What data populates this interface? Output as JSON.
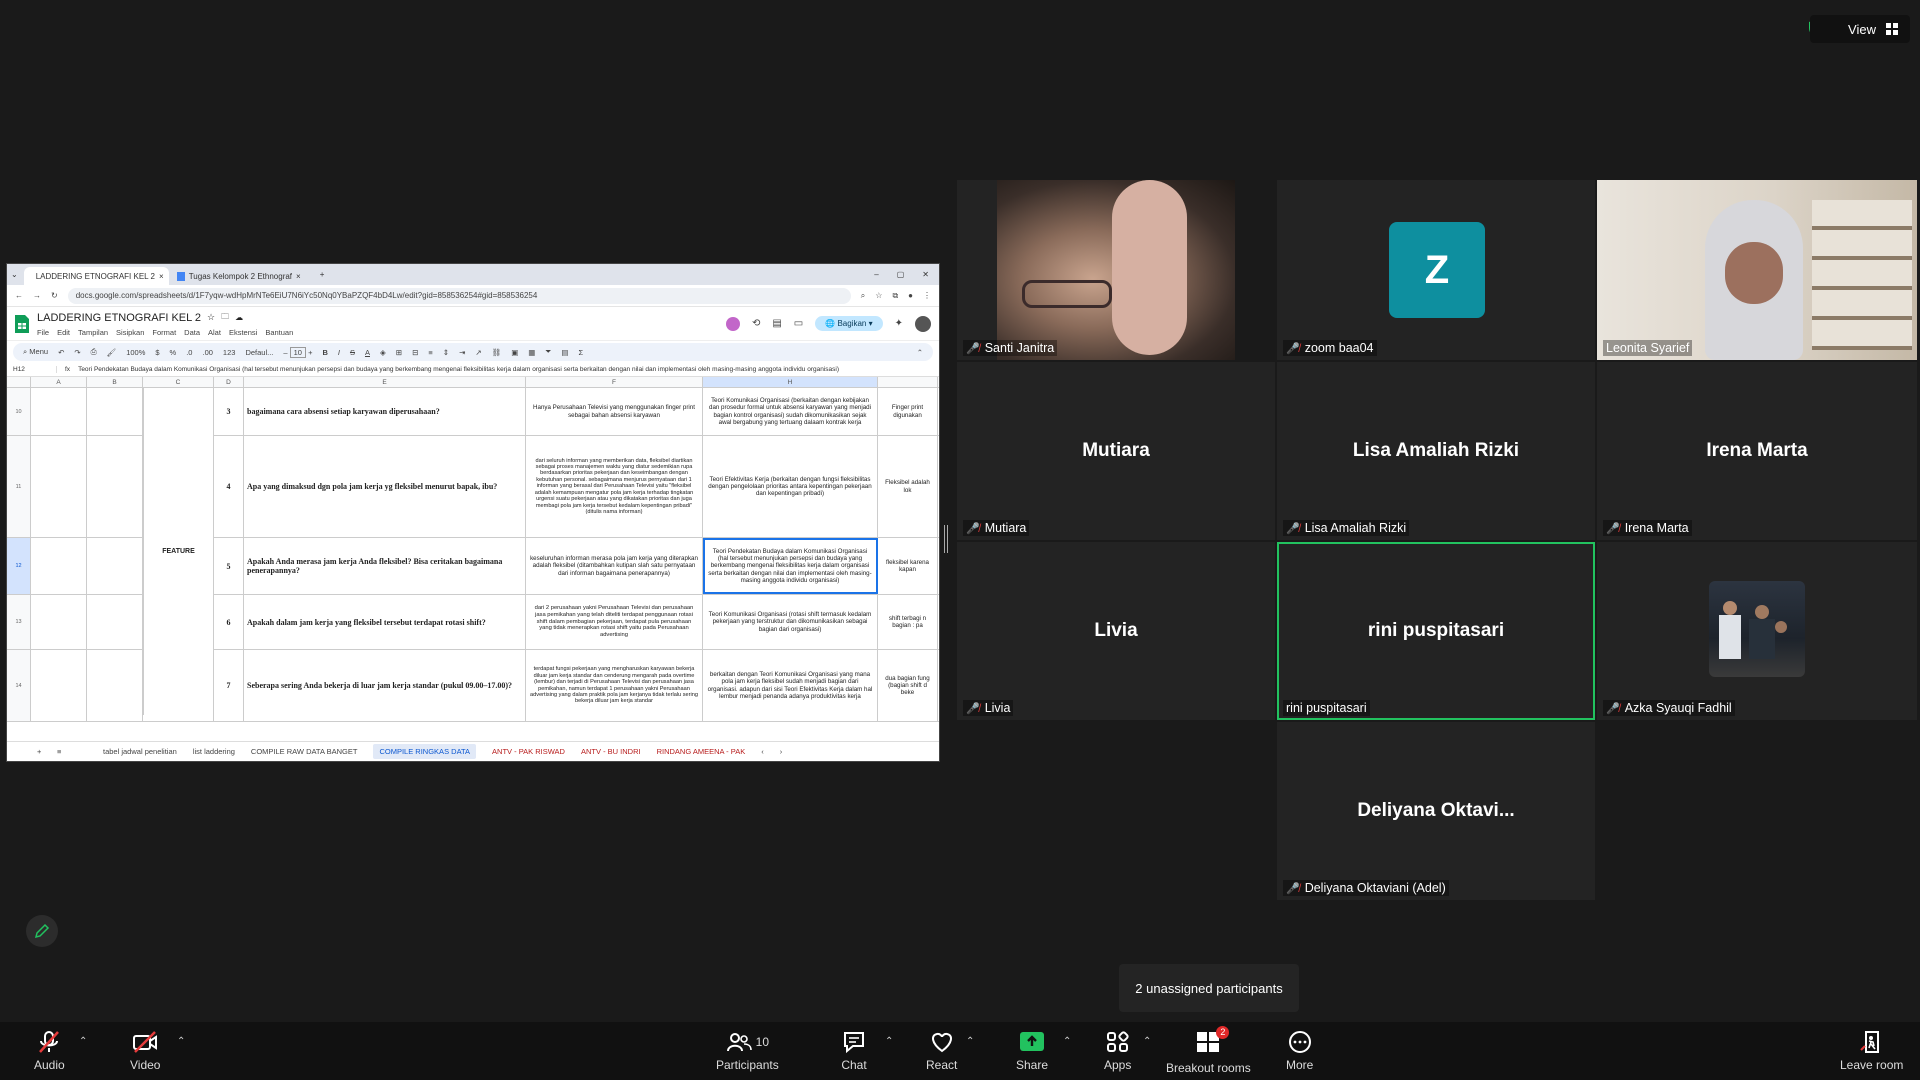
{
  "top": {
    "view_label": "View"
  },
  "browser": {
    "tabs": [
      "LADDERING ETNOGRAFI KEL 2",
      "Tugas Kelompok 2 Ethnograf"
    ],
    "url": "docs.google.com/spreadsheets/d/1F7yqw-wdHpMrNTe6EiU7N6iYc50Nq0YBaPZQF4bD4Lw/edit?gid=858536254#gid=858536254"
  },
  "sheets": {
    "title": "LADDERING ETNOGRAFI KEL 2",
    "menus": [
      "File",
      "Edit",
      "Tampilan",
      "Sisipkan",
      "Format",
      "Data",
      "Alat",
      "Ekstensi",
      "Bantuan"
    ],
    "share_label": "Bagikan",
    "toolbar": {
      "menu": "Menu",
      "zoom": "100%",
      "currency": "$",
      "percent": "%",
      "dec1": ".0",
      "dec2": ".00",
      "fmt123": "123",
      "font": "Defaul...",
      "font_size": "10"
    },
    "cell_ref": "H12",
    "formula": "Teori Pendekatan Budaya dalam Komunikasi Organisasi (hal tersebut menunjukan persepsi dan budaya yang berkembang mengenai fleksibilitas kerja dalam organisasi serta berkaitan dengan nilai dan implementasi oleh masing-masing anggota individu organisasi)",
    "columns": [
      "A",
      "B",
      "C",
      "D",
      "E",
      "F",
      "G",
      "H"
    ],
    "feature_label": "FEATURE",
    "rows": [
      {
        "rn": "10",
        "no": "3",
        "q": "bagaimana cara absensi setiap karyawan diperusahaan?",
        "f": "Hanya Perusahaan Televisi yang menggunakan finger print sebagai bahan absensi karyawan",
        "h": "Teori Komunikasi Organisasi (berkaitan dengan kebijakan dan prosedur formal untuk absensi karyawan yang menjadi bagian kontrol organisasi) sudah dikomunikasikan sejak awal bergabung yang tertuang dalaam kontrak kerja",
        "i": "Finger print digunakan"
      },
      {
        "rn": "11",
        "no": "4",
        "q": "Apa yang dimaksud dgn pola jam kerja yg fleksibel menurut bapak, ibu?",
        "f": "dari seluruh informan yang memberikan data, fleksibel diartikan sebagai proses manajemen waktu yang diatur sedemikian rupa berdasarkan prioritas pekerjaan dan keseimbangan dengan kebutuhan personal. sebagaimana menjurus pernyataan dari 1 informan yang berasal dari Perusahaan Televisi yaitu \"fleksibel adalah kemampuan mengatur pola jam kerja terhadap tingkatan urgensi suatu pekerjaan atau yang dikatakan prioritas dan juga membagi pola jam kerja tersebut kedalam kepentingan pribadi\" (ditulis nama informan)",
        "h": "Teori Efektivitas Kerja (berkaitan dengan fungsi fleksibilitas dengan pengelolaan prioritas antara kepentingan pekerjaan dan kepentingan pribadi)",
        "i": "Fleksibel adalah lok"
      },
      {
        "rn": "12",
        "no": "5",
        "q": "Apakah Anda merasa jam kerja Anda fleksibel? Bisa ceritakan bagaimana penerapannya?",
        "f": "keseluruhan informan merasa pola jam kerja yang diterapkan adalah fleksibel (ditambahkan kutipan slah satu pernyataan dari informan bagaimana penerapannya)",
        "h": "Teori Pendekatan Budaya dalam Komunikasi Organisasi (hal tersebut menunjukan persepsi dan budaya yang berkembang mengenai fleksibilitas kerja dalam organisasi serta berkaitan dengan nilai dan implementasi oleh masing-masing anggota individu organisasi)",
        "i": "fleksibel karena kapan"
      },
      {
        "rn": "13",
        "no": "6",
        "q": "Apakah dalam jam kerja yang fleksibel tersebut terdapat rotasi shift?",
        "f": "dari 2 perusahaan yakni Perusahaan Televisi dan perusahaan jasa pemikahan yang telah diteliti terdapat penggunaan rotasi shift dalam pembagian pekerjaan, terdapat pula perusahaan yang tidak menerapkan rotasi shift yaitu pada Perusahaan advertising",
        "h": "Teori Komunikasi Organisasi (rotasi shift termasuk kedalam pekerjaan yang terstruktur dan dikomunikasikan sebagai bagian dari organisasi)",
        "i": "shift terbagi n bagian : pa"
      },
      {
        "rn": "14",
        "no": "7",
        "q": "Seberapa sering Anda bekerja di luar jam kerja standar (pukul 09.00–17.00)?",
        "f": "terdapat fungsi pekerjaan yang mengharuskan karyawan bekerja diluar jam kerja standar dan cenderung mengarah pada overtime (lembur) dan terjadi di Perusahaan Televisi dan perusahaan jasa pemikahan, namun terdapat 1 perusahaan yakni Perusahaan advertising yang dalam praktik pola jam kerjanya tidak terlalu sering bekerja diluar jam kerja standar",
        "h": "berkaitan dengan Teori Komunikasi Organisasi yang mana pola jam kerja fleksibel sudah menjadi bagian dari organisasi. adapun dari sisi Teori Efektivitas Kerja dalam hal lembur menjadi penanda adanya produktivitas kerja",
        "i": "dua bagian fung (bagian shift d beke"
      }
    ],
    "sheet_tabs": [
      "tabel jadwal penelitian",
      "list laddering",
      "COMPILE RAW DATA BANGET",
      "COMPILE RINGKAS DATA",
      "ANTV - PAK RISWAD",
      "ANTV - BU INDRI",
      "RINDANG AMEENA - PAK"
    ]
  },
  "participants": {
    "santi": "Santi Janitra",
    "zoom_avatar": "Z",
    "zoom": "zoom baa04",
    "leonita": "Leonita Syarief",
    "mutiara": "Mutiara",
    "lisa_big": "Lisa Amaliah Rizki",
    "lisa": "Lisa Amaliah Rizki",
    "irena_big": "Irena Marta",
    "irena": "Irena Marta",
    "livia_big": "Livia",
    "livia": "Livia",
    "rini_big": "rini puspitasari",
    "rini": "rini puspitasari",
    "azka": "Azka Syauqi Fadhil",
    "deliyana_big": "Deliyana  Oktavi...",
    "deliyana": "Deliyana Oktaviani (Adel)"
  },
  "unassigned": "2 unassigned participants",
  "controls": {
    "audio": "Audio",
    "video": "Video",
    "participants": "Participants",
    "participants_count": "10",
    "chat": "Chat",
    "react": "React",
    "share": "Share",
    "apps": "Apps",
    "breakout": "Breakout rooms",
    "breakout_badge": "2",
    "more": "More",
    "leave": "Leave room"
  },
  "colors": {
    "active_speaker": "#22c25f",
    "share_green": "#22c25f",
    "zoom_avatar_bg": "#0e8f9f",
    "mic_off": "#e53b3b"
  }
}
